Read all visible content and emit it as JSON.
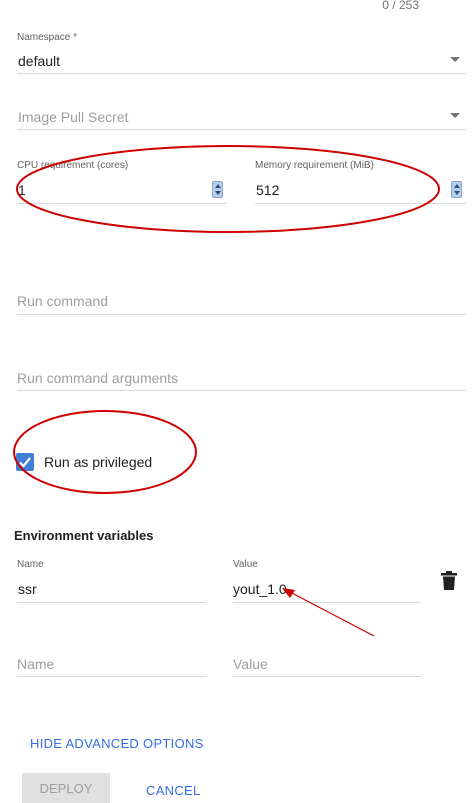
{
  "counter": "0 / 253",
  "namespace": {
    "label": "Namespace *",
    "value": "default"
  },
  "image_pull_secret": {
    "placeholder": "Image Pull Secret"
  },
  "cpu": {
    "label": "CPU requirement (cores)",
    "value": "1"
  },
  "memory": {
    "label": "Memory requirement (MiB)",
    "value": "512"
  },
  "run_command": {
    "placeholder": "Run command"
  },
  "run_command_args": {
    "placeholder": "Run command arguments"
  },
  "privileged": {
    "label": "Run as privileged",
    "checked": true
  },
  "env": {
    "title": "Environment variables",
    "name_label": "Name",
    "value_label": "Value",
    "row1_name": "ssr",
    "row1_value": "yout_1.0",
    "name_placeholder": "Name",
    "value_placeholder": "Value"
  },
  "actions": {
    "hide_advanced": "HIDE ADVANCED OPTIONS",
    "deploy": "DEPLOY",
    "cancel": "CANCEL"
  },
  "colors": {
    "accent": "#326de6",
    "annotation": "#cc0000",
    "checkbox": "#3f7fd6"
  }
}
